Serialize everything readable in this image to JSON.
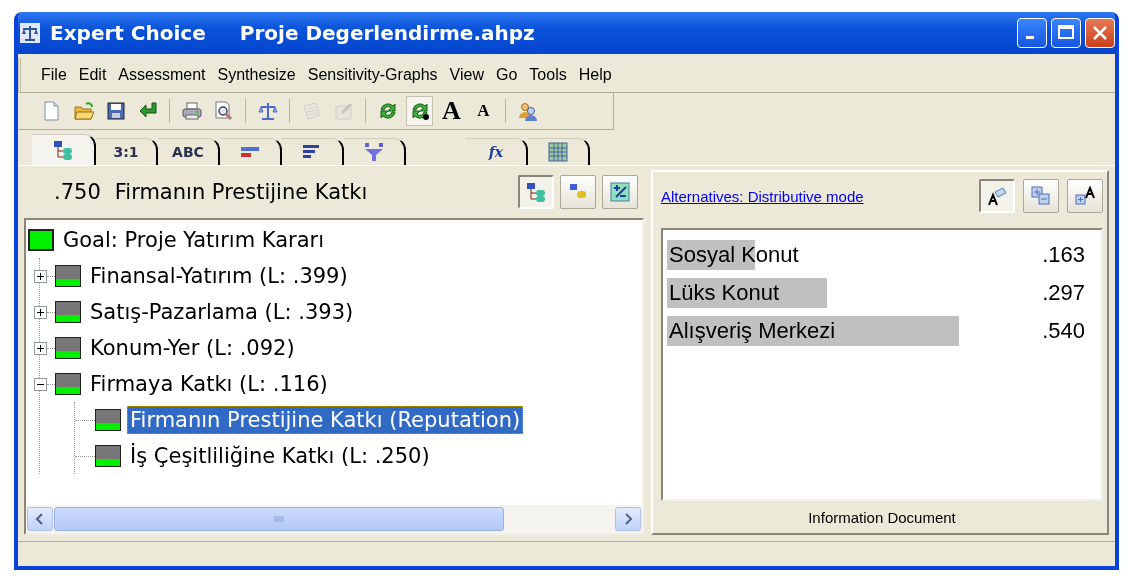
{
  "window": {
    "title": "Expert Choice",
    "document": "Proje Degerlendirme.ahpz"
  },
  "menu": [
    "File",
    "Edit",
    "Assessment",
    "Synthesize",
    "Sensitivity-Graphs",
    "View",
    "Go",
    "Tools",
    "Help"
  ],
  "toolbar": [
    {
      "kind": "new-file",
      "pressed": false,
      "disabled": false
    },
    {
      "kind": "open-folder",
      "pressed": false,
      "disabled": false
    },
    {
      "kind": "save",
      "pressed": false,
      "disabled": false
    },
    {
      "kind": "enter-arrow",
      "pressed": false,
      "disabled": false
    },
    {
      "kind": "separator"
    },
    {
      "kind": "print",
      "pressed": false,
      "disabled": false
    },
    {
      "kind": "preview",
      "pressed": false,
      "disabled": false
    },
    {
      "kind": "separator"
    },
    {
      "kind": "balance",
      "pressed": false,
      "disabled": false
    },
    {
      "kind": "separator"
    },
    {
      "kind": "sheet",
      "pressed": false,
      "disabled": true
    },
    {
      "kind": "tool",
      "pressed": false,
      "disabled": true
    },
    {
      "kind": "separator"
    },
    {
      "kind": "refresh",
      "pressed": false,
      "disabled": false
    },
    {
      "kind": "refresh-dot",
      "pressed": true,
      "disabled": false
    },
    {
      "kind": "font-larger",
      "label": "A",
      "pressed": false,
      "disabled": false
    },
    {
      "kind": "font-smaller",
      "label": "A",
      "pressed": false,
      "disabled": false
    },
    {
      "kind": "separator"
    },
    {
      "kind": "users",
      "pressed": false,
      "disabled": false
    }
  ],
  "tabs": [
    {
      "kind": "hierarchy",
      "selected": true
    },
    {
      "kind": "text",
      "label": "3:1",
      "selected": false
    },
    {
      "kind": "text",
      "label": "ABC",
      "selected": false
    },
    {
      "kind": "bars-two",
      "selected": false
    },
    {
      "kind": "bars",
      "selected": false
    },
    {
      "kind": "funnel",
      "selected": false
    }
  ],
  "tabs_right": [
    {
      "kind": "formula",
      "label": "fx",
      "selected": false
    },
    {
      "kind": "grid",
      "selected": false
    }
  ],
  "left_pane": {
    "priority": ".750",
    "node": "Firmanın Prestijine Katkı",
    "buttons": [
      {
        "kind": "hierarchy",
        "pressed": true
      },
      {
        "kind": "nodes",
        "pressed": false
      },
      {
        "kind": "plus-minus",
        "pressed": false
      }
    ]
  },
  "tree": {
    "label": "Goal: Proje Yatırım Kararı",
    "selected": false,
    "children": [
      {
        "label": "Finansal-Yatırım (L: .399)",
        "selected": false,
        "expanded": false
      },
      {
        "label": "Satış-Pazarlama (L: .393)",
        "selected": false,
        "expanded": false
      },
      {
        "label": "Konum-Yer (L: .092)",
        "selected": false,
        "expanded": false
      },
      {
        "label": "Firmaya Katkı (L: .116)",
        "selected": false,
        "expanded": true,
        "children": [
          {
            "label": "Firmanın Prestijine Katkı (Reputation)",
            "selected": true
          },
          {
            "label": "İş Çeşitliliğine Katkı (L: .250)",
            "selected": false
          }
        ]
      }
    ]
  },
  "right_pane": {
    "link": "Alternatives: Distributive mode",
    "buttons": [
      {
        "kind": "note",
        "pressed": true
      },
      {
        "kind": "plus-minus-boxes",
        "pressed": false
      },
      {
        "kind": "add-letter",
        "pressed": false
      }
    ],
    "alternatives": [
      {
        "name": "Sosyal Konut",
        "value": ".163"
      },
      {
        "name": "Lüks Konut",
        "value": ".297"
      },
      {
        "name": "Alışveriş Merkezi",
        "value": ".540"
      }
    ],
    "footer": "Information Document"
  }
}
